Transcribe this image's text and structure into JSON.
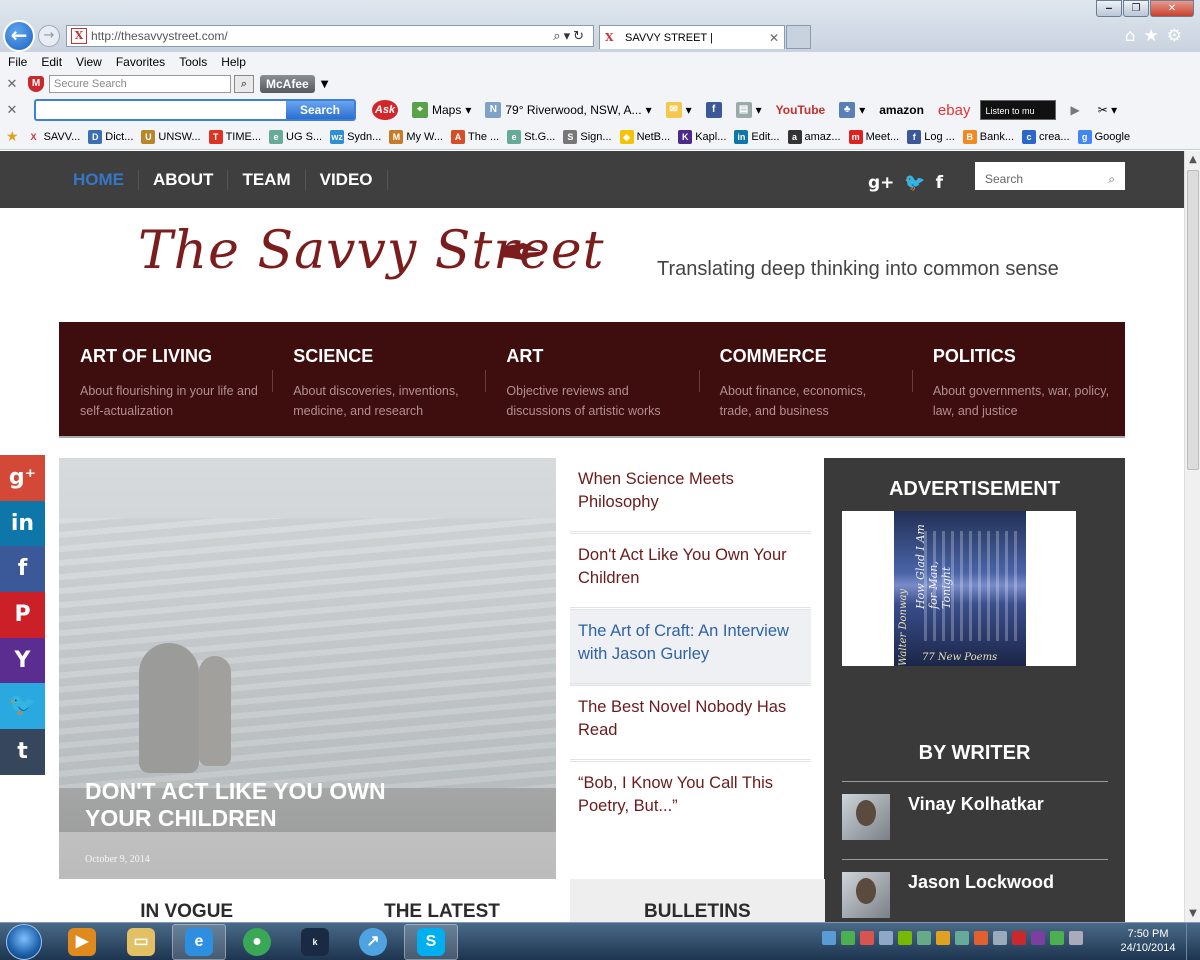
{
  "browser": {
    "url": "http://thesavvystreet.com/",
    "tab_title": "SAVVY STREET |",
    "menu": [
      "File",
      "Edit",
      "View",
      "Favorites",
      "Tools",
      "Help"
    ],
    "secure_search_placeholder": "Secure Search",
    "mcafee_label": "McAfee",
    "search_button": "Search",
    "ask_label": "Ask",
    "maps_label": "Maps",
    "weather_label": "79° Riverwood, NSW, A...",
    "youtube_label": "YouTube",
    "amazon_label": "amazon",
    "ebay_label": "ebay",
    "listen_label": "Listen to mu",
    "favorites": [
      "SAVV...",
      "Dict...",
      "UNSW...",
      "TIME...",
      "UG S...",
      "Sydn...",
      "My W...",
      "The ...",
      "St.G...",
      "Sign...",
      "NetB...",
      "Kapl...",
      "Edit...",
      "amaz...",
      "Meet...",
      "Log ...",
      "Bank...",
      "crea...",
      "Google"
    ]
  },
  "site": {
    "nav": [
      "HOME",
      "ABOUT",
      "TEAM",
      "VIDEO"
    ],
    "search_placeholder": "Search",
    "logo_text": "The Savvy Street",
    "tagline": "Translating deep thinking into common sense",
    "categories": [
      {
        "title": "ART OF LIVING",
        "desc": "About flourishing in your life and self-actualization"
      },
      {
        "title": "SCIENCE",
        "desc": "About discoveries, inventions, medicine, and research"
      },
      {
        "title": "ART",
        "desc": "Objective reviews and discussions of artistic works"
      },
      {
        "title": "COMMERCE",
        "desc": "About finance, economics, trade, and business"
      },
      {
        "title": "POLITICS",
        "desc": "About governments, war, policy, law, and justice"
      }
    ],
    "feature": {
      "title": "DON'T ACT LIKE YOU OWN YOUR CHILDREN",
      "date": "October 9, 2014"
    },
    "articles": [
      "When Science Meets Philosophy",
      "Don't Act Like You Own Your Children",
      "The Art of Craft: An Interview with Jason Gurley",
      "The Best Novel Nobody Has Read",
      "“Bob, I Know You Call This Poetry, But...”"
    ],
    "sidebar": {
      "ad_heading": "ADVERTISEMENT",
      "book_title": "How Glad I Am for Man, Tonight",
      "book_author": "Walter Donway",
      "book_footer": "77 New Poems",
      "writers_heading": "BY WRITER",
      "writers": [
        "Vinay Kolhatkar",
        "Jason Lockwood"
      ]
    },
    "bottom_tabs": [
      "IN VOGUE",
      "THE LATEST",
      "BULLETINS"
    ],
    "share": [
      "g+",
      "in",
      "f",
      "P",
      "Y",
      "bird",
      "t"
    ]
  },
  "taskbar": {
    "time": "7:50 PM",
    "date": "24/10/2014"
  },
  "colors": {
    "nav_bg": "#3f3f3f",
    "nav_active": "#3577c4",
    "category_bg": "#3e0e0e",
    "accent_maroon": "#7b1d1d",
    "sidebar_bg": "#3a3a3a"
  }
}
